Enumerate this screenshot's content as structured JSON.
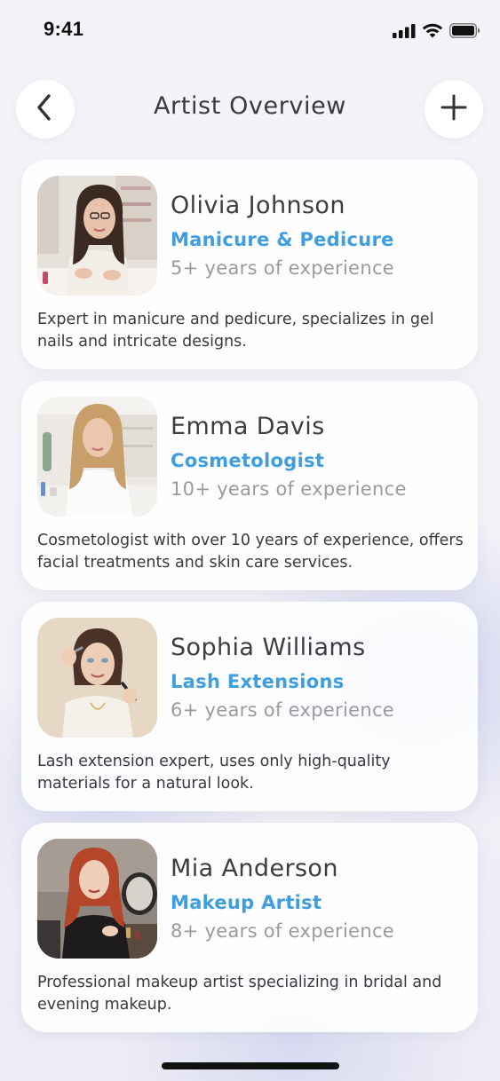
{
  "status_bar": {
    "time": "9:41",
    "icons": [
      "cellular-signal-icon",
      "wifi-icon",
      "battery-icon"
    ]
  },
  "header": {
    "title": "Artist Overview",
    "back_icon": "chevron-left-icon",
    "add_icon": "plus-icon"
  },
  "colors": {
    "accent": "#3e9ee0",
    "muted_text": "#9a9a9f",
    "card_background": "#ffffff"
  },
  "artists": [
    {
      "name": "Olivia Johnson",
      "specialty": "Manicure & Pedicure",
      "experience": "5+ years of experience",
      "description": "Expert in manicure and pedicure, specializes in gel nails and intricate designs."
    },
    {
      "name": "Emma Davis",
      "specialty": "Cosmetologist",
      "experience": "10+ years of experience",
      "description": "Cosmetologist with over 10 years of experience, offers facial treatments and skin care services."
    },
    {
      "name": "Sophia Williams",
      "specialty": "Lash Extensions",
      "experience": "6+ years of experience",
      "description": "Lash extension expert, uses only high-quality materials for a natural look."
    },
    {
      "name": "Mia Anderson",
      "specialty": "Makeup Artist",
      "experience": "8+ years of experience",
      "description": "Professional makeup artist specializing in bridal and evening makeup."
    }
  ]
}
